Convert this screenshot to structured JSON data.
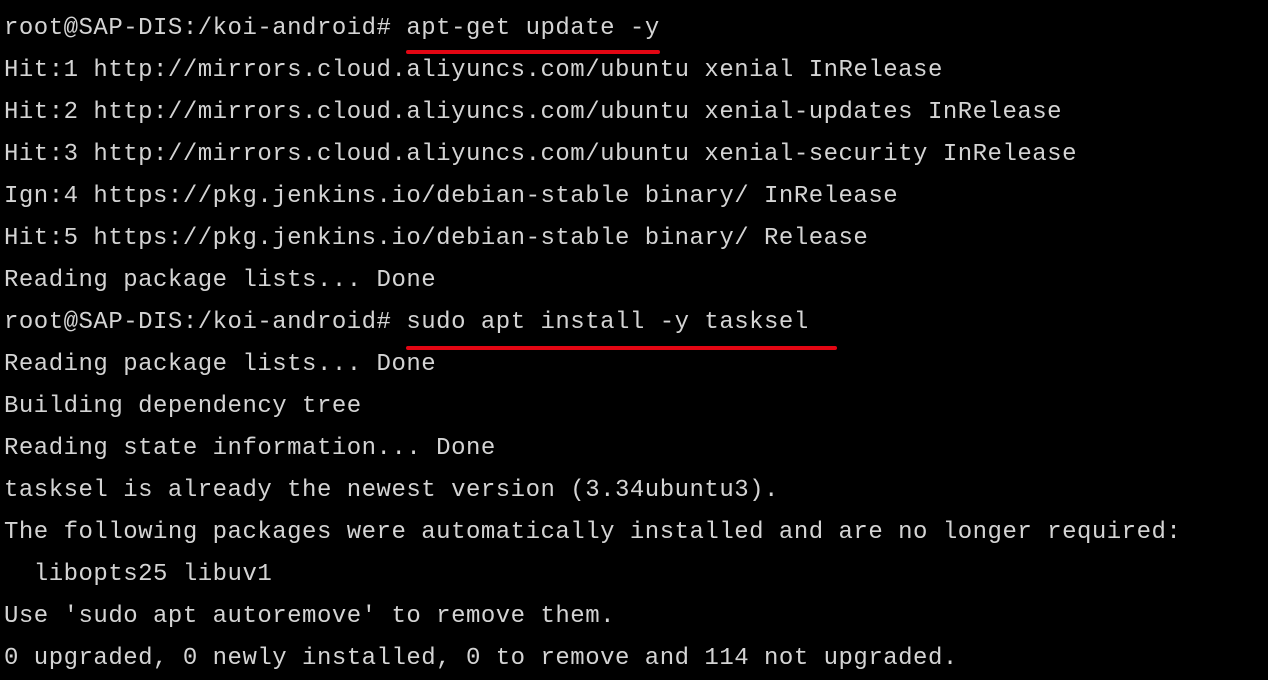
{
  "terminal": {
    "prompt1": "root@SAP-DIS:/koi-android# ",
    "command1": "apt-get update -y",
    "line1": "Hit:1 http://mirrors.cloud.aliyuncs.com/ubuntu xenial InRelease",
    "line2": "Hit:2 http://mirrors.cloud.aliyuncs.com/ubuntu xenial-updates InRelease",
    "line3": "Hit:3 http://mirrors.cloud.aliyuncs.com/ubuntu xenial-security InRelease",
    "line4": "Ign:4 https://pkg.jenkins.io/debian-stable binary/ InRelease",
    "line5": "Hit:5 https://pkg.jenkins.io/debian-stable binary/ Release",
    "line6": "Reading package lists... Done",
    "prompt2": "root@SAP-DIS:/koi-android# ",
    "command2": "sudo apt install -y tasksel",
    "line7": "Reading package lists... Done",
    "line8": "Building dependency tree",
    "line9": "Reading state information... Done",
    "line10": "tasksel is already the newest version (3.34ubuntu3).",
    "line11": "The following packages were automatically installed and are no longer required:",
    "line12": "  libopts25 libuv1",
    "line13": "Use 'sudo apt autoremove' to remove them.",
    "line14": "0 upgraded, 0 newly installed, 0 to remove and 114 not upgraded."
  }
}
